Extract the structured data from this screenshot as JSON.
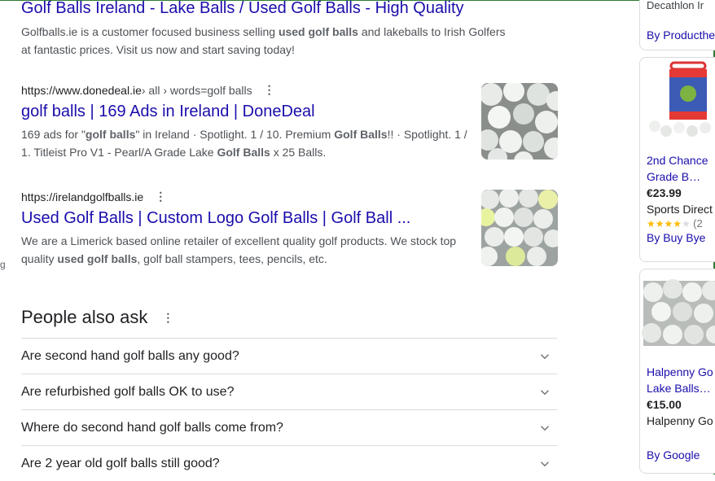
{
  "results": [
    {
      "title": "Golf Balls Ireland - Lake Balls / Used Golf Balls - High Quality",
      "snippet_line1_a": "Golfballs.ie is a customer focused business selling ",
      "snippet_line1_b": "used golf balls",
      "snippet_line1_c": " and lakeballs to Irish Golfers",
      "snippet_line2": "at fantastic prices. Visit us now and start saving today!"
    },
    {
      "url": "https://www.donedeal.ie",
      "crumb": " › all › words=golf balls",
      "title": "golf balls | 169 Ads in Ireland | DoneDeal",
      "snippet_a": "169 ads for \"",
      "snippet_b": "golf balls",
      "snippet_c": "\" in Ireland · Spotlight. 1 / 10. Premium ",
      "snippet_d": "Golf Balls",
      "snippet_e": "!! · Spotlight. 1 /",
      "snippet2_a": "1. Titleist Pro V1 - Pearl/A Grade Lake ",
      "snippet2_b": "Golf Balls",
      "snippet2_c": " x 25 Balls."
    },
    {
      "url": "https://irelandgolfballs.ie",
      "title": "Used Golf Balls | Custom Logo Golf Balls | Golf Ball ...",
      "snippet1": "We are a Limerick based online retailer of excellent quality golf products. We stock top",
      "snippet2_a": "quality ",
      "snippet2_b": "used golf balls",
      "snippet2_c": ", golf ball stampers, tees, pencils, etc."
    }
  ],
  "paa": {
    "heading": "People also ask",
    "questions": [
      "Are second hand golf balls any good?",
      "Are refurbished golf balls OK to use?",
      "Where do second hand golf balls come from?",
      "Are 2 year old golf balls still good?"
    ]
  },
  "side": {
    "top_text": "Decathlon Ir",
    "top_link": "By Producthe",
    "card1": {
      "title1": "2nd Chance",
      "title2": "Grade B…",
      "price": "€23.99",
      "seller": "Sports Direct",
      "rating": 4,
      "rating_count": "(2",
      "by": "By Buy Bye"
    },
    "card2": {
      "title1": "Halpenny Go",
      "title2": "Lake Balls…",
      "price": "€15.00",
      "seller": "Halpenny Go",
      "by": "By Google"
    }
  },
  "left_edge_mark": "g",
  "icons": {
    "more": "vertical-dots-icon",
    "expand": "chevron-down-icon"
  },
  "colors": {
    "link": "#1a0dab",
    "text": "#4d5156",
    "star": "#fbbc04"
  }
}
